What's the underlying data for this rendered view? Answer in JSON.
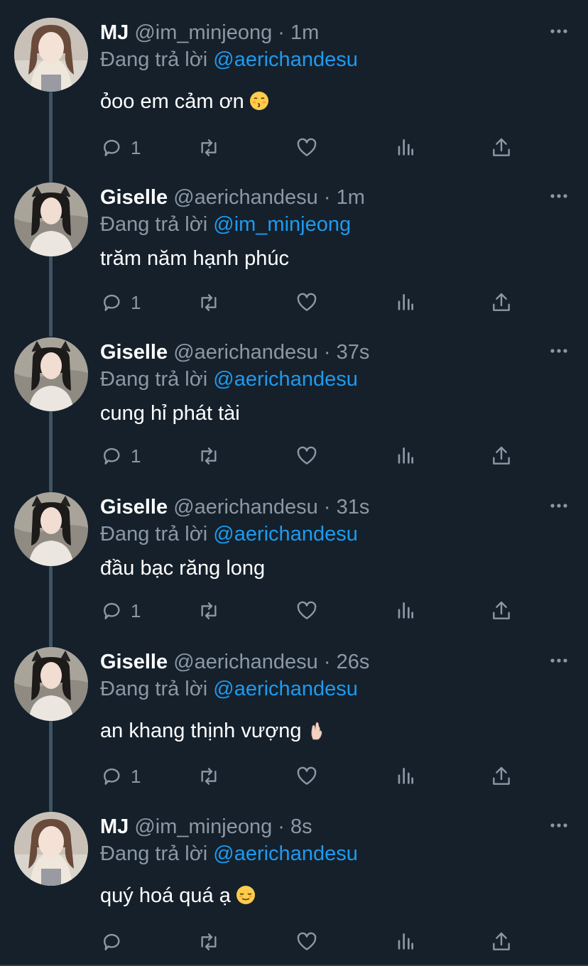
{
  "reply_prefix": "Đang trả lời",
  "separator": "·",
  "colors": {
    "background": "#15202b",
    "secondary_text": "#8b98a5",
    "mention": "#1d9bf0",
    "thread_line": "#3d5466"
  },
  "tweets": [
    {
      "author": {
        "name": "MJ",
        "handle": "@im_minjeong"
      },
      "time": "1m",
      "reply_to": "@aerichandesu",
      "text": "ỏoo em cảm ơn",
      "emoji": "kissing-face-with-closed-eyes",
      "reply_count": "1"
    },
    {
      "author": {
        "name": "Giselle",
        "handle": "@aerichandesu"
      },
      "time": "1m",
      "reply_to": "@im_minjeong",
      "text": "trăm năm hạnh phúc",
      "emoji": "",
      "reply_count": "1"
    },
    {
      "author": {
        "name": "Giselle",
        "handle": "@aerichandesu"
      },
      "time": "37s",
      "reply_to": "@aerichandesu",
      "text": "cung hỉ phát tài",
      "emoji": "",
      "reply_count": "1"
    },
    {
      "author": {
        "name": "Giselle",
        "handle": "@aerichandesu"
      },
      "time": "31s",
      "reply_to": "@aerichandesu",
      "text": "đầu bạc răng long",
      "emoji": "",
      "reply_count": "1"
    },
    {
      "author": {
        "name": "Giselle",
        "handle": "@aerichandesu"
      },
      "time": "26s",
      "reply_to": "@aerichandesu",
      "text": "an khang thịnh vượng",
      "emoji": "hand-with-index-finger-and-thumb-crossed",
      "reply_count": "1"
    },
    {
      "author": {
        "name": "MJ",
        "handle": "@im_minjeong"
      },
      "time": "8s",
      "reply_to": "@aerichandesu",
      "text": "quý hoá quá ạ",
      "emoji": "relieved-face",
      "reply_count": ""
    }
  ]
}
